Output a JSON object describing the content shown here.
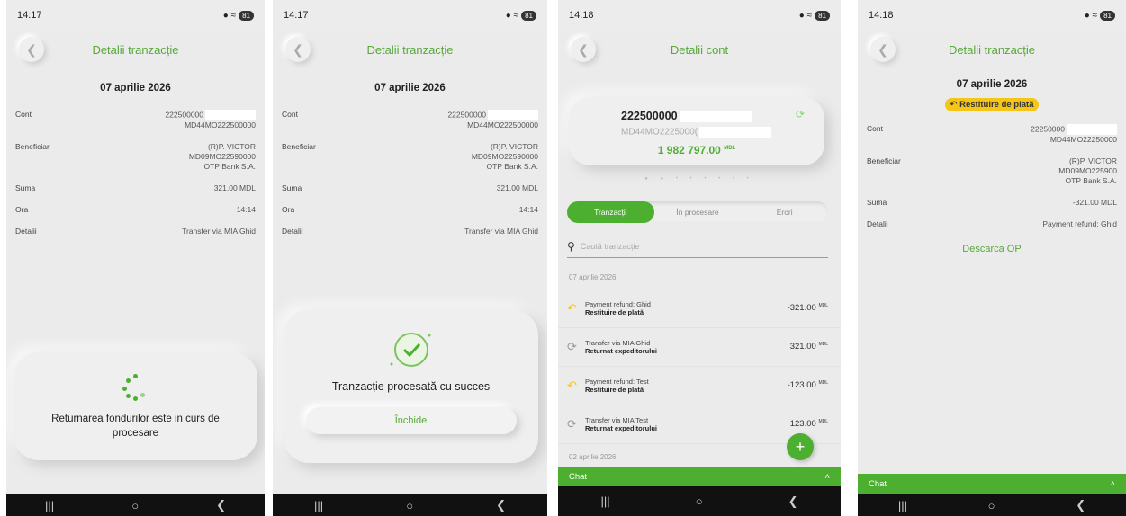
{
  "screens": [
    {
      "status": {
        "time": "14:17",
        "battery": "81"
      },
      "header": {
        "title": "Detalii tranzacție"
      },
      "date": "07 aprilie 2026",
      "rows": {
        "cont": {
          "label": "Cont",
          "v1": "222500000",
          "v2": "MD44MO222500000"
        },
        "benef": {
          "label": "Beneficiar",
          "v1": "(R)P. VICTOR",
          "v2": "MD09MO22590000",
          "v3": "OTP Bank S.A."
        },
        "suma": {
          "label": "Suma",
          "value": "321.00 MDL"
        },
        "ora": {
          "label": "Ora",
          "value": "14:14"
        },
        "detalii": {
          "label": "Detalii",
          "value": "Transfer via MIA Ghid"
        }
      },
      "loading_text": "Returnarea fondurilor este in curs de procesare"
    },
    {
      "status": {
        "time": "14:17",
        "battery": "81"
      },
      "header": {
        "title": "Detalii tranzacție"
      },
      "date": "07 aprilie 2026",
      "rows": {
        "cont": {
          "label": "Cont",
          "v1": "222500000",
          "v2": "MD44MO222500000"
        },
        "benef": {
          "label": "Beneficiar",
          "v1": "(R)P. VICTOR",
          "v2": "MD09MO22590000",
          "v3": "OTP Bank S.A."
        },
        "suma": {
          "label": "Suma",
          "value": "321.00 MDL"
        },
        "ora": {
          "label": "Ora",
          "value": "14:14"
        },
        "detalii": {
          "label": "Detalii",
          "value": "Transfer via MIA Ghid"
        }
      },
      "success_text": "Tranzacție procesată cu succes",
      "close_label": "Închide"
    },
    {
      "status": {
        "time": "14:18",
        "battery": "81"
      },
      "header": {
        "title": "Detalii cont"
      },
      "account": {
        "number": "222500000",
        "iban": "MD44MO2225000(",
        "balance": "1 982 797.00",
        "currency": "MDL"
      },
      "tabs": [
        "Tranzacții",
        "În procesare",
        "Erori"
      ],
      "search_placeholder": "Caută tranzacție",
      "group1_date": "07 aprilie 2026",
      "transactions": [
        {
          "title": "Payment refund: Ghid",
          "subtitle": "Restituire de plată",
          "amount": "-321.00",
          "currency": "MDL"
        },
        {
          "title": "Transfer via MIA Ghid",
          "subtitle": "Returnat expeditorului",
          "amount": "321.00",
          "currency": "MDL"
        },
        {
          "title": "Payment refund: Test",
          "subtitle": "Restituire de plată",
          "amount": "-123.00",
          "currency": "MDL"
        },
        {
          "title": "Transfer via MIA Test",
          "subtitle": "Returnat expeditorului",
          "amount": "123.00",
          "currency": "MDL"
        }
      ],
      "group2_date": "02 aprilie 2026",
      "chat_label": "Chat"
    },
    {
      "status": {
        "time": "14:18",
        "battery": "81"
      },
      "header": {
        "title": "Detalii tranzacție"
      },
      "date": "07 aprilie 2026",
      "badge": "Restituire de plată",
      "rows": {
        "cont": {
          "label": "Cont",
          "v1": "22250000",
          "v2": "MD44MO22250000"
        },
        "benef": {
          "label": "Beneficiar",
          "v1": "(R)P. VICTOR",
          "v2": "MD09MO225900",
          "v3": "OTP Bank S.A."
        },
        "suma": {
          "label": "Suma",
          "value": "-321.00 MDL"
        },
        "detalii": {
          "label": "Detalii",
          "value": "Payment refund: Ghid"
        }
      },
      "download_label": "Descarca OP",
      "chat_label": "Chat"
    }
  ]
}
